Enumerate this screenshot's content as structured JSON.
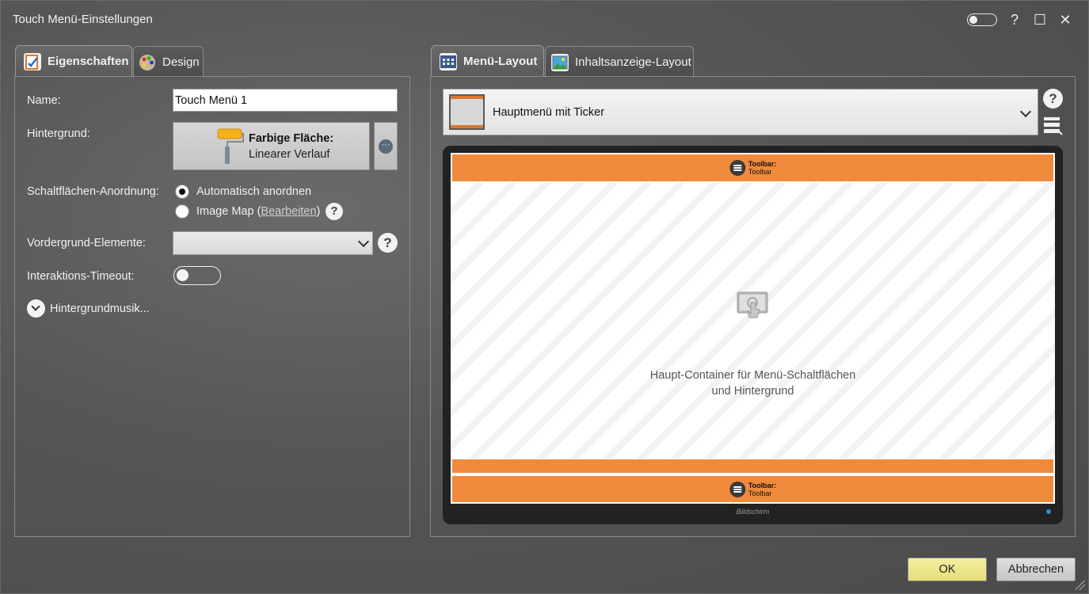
{
  "window": {
    "title": "Touch Menü-Einstellungen",
    "help": "?",
    "maximize": "☐",
    "close": "✕"
  },
  "left_tabs": [
    {
      "label": "Eigenschaften",
      "active": true
    },
    {
      "label": "Design",
      "active": false
    }
  ],
  "right_tabs": [
    {
      "label": "Menü-Layout",
      "active": true
    },
    {
      "label": "Inhaltsanzeige-Layout",
      "active": false
    }
  ],
  "props": {
    "name_label": "Name:",
    "name_value": "Touch Menü 1",
    "background_label": "Hintergrund:",
    "background_title": "Farbige Fläche:",
    "background_sub": "Linearer Verlauf",
    "more_glyph": "···",
    "arrangement_label": "Schaltflächen-Anordnung:",
    "arrangement_auto": "Automatisch anordnen",
    "arrangement_imagemap_pre": "Image Map (",
    "arrangement_imagemap_link": "Bearbeiten",
    "arrangement_imagemap_post": ")",
    "foreground_label": "Vordergrund-Elemente:",
    "foreground_value": "",
    "timeout_label": "Interaktions-Timeout:",
    "timeout_on": false,
    "music_label": "Hintergrundmusik..."
  },
  "layout": {
    "selected": "Hauptmenü mit Ticker",
    "toolbar_title": "Toolbar:",
    "toolbar_sub": "Toolbar",
    "content_line1": "Haupt-Container für Menü-Schaltflächen",
    "content_line2": "und Hintergrund",
    "screen_label": "Bildschirm"
  },
  "buttons": {
    "ok": "OK",
    "cancel": "Abbrechen"
  },
  "colors": {
    "accent_orange": "#f08a3c",
    "ok_yellow": "#ece691",
    "toolbar_orange": "#d9782f"
  },
  "help_glyph": "?"
}
